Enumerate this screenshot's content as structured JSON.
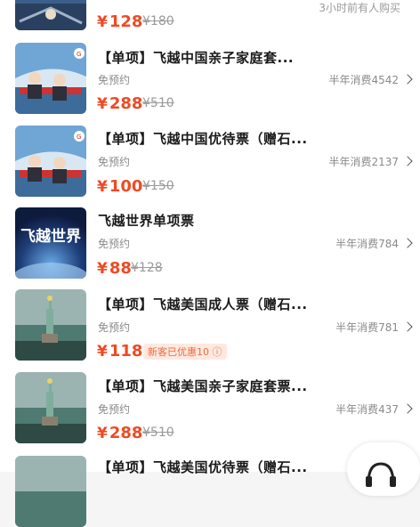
{
  "colors": {
    "price": "#ef4a23",
    "accent": "#ef6a3a"
  },
  "top_item": {
    "price": "128",
    "original_price": "¥180",
    "note": "3小时前有人购买"
  },
  "products": [
    {
      "title": "【单项】飞越中国亲子家庭套...",
      "tag": "免预约",
      "sold": "半年消费4542",
      "price": "288",
      "original_price": "¥510",
      "thumb": "flying-theater"
    },
    {
      "title": "【单项】飞越中国优待票（赠石...",
      "tag": "免预约",
      "sold": "半年消费2137",
      "price": "100",
      "original_price": "¥150",
      "thumb": "flying-theater"
    },
    {
      "title": "飞越世界单项票",
      "tag": "免预约",
      "sold": "半年消费784",
      "price": "88",
      "original_price": "¥128",
      "thumb": "world-poster",
      "thumb_text": "飞越世界"
    },
    {
      "title": "【单项】飞越美国成人票（赠石...",
      "tag": "免预约",
      "sold": "半年消费781",
      "price": "118",
      "original_price": "",
      "promo": "新客已优惠10",
      "thumb": "statue-of-liberty"
    },
    {
      "title": "【单项】飞越美国亲子家庭套票...",
      "tag": "免预约",
      "sold": "半年消费437",
      "price": "288",
      "original_price": "¥510",
      "thumb": "statue-of-liberty"
    },
    {
      "title": "【单项】飞越美国优待票（赠石...",
      "thumb": "statue-of-liberty"
    }
  ],
  "currency_symbol": "¥",
  "float_button_icon": "headset-icon"
}
